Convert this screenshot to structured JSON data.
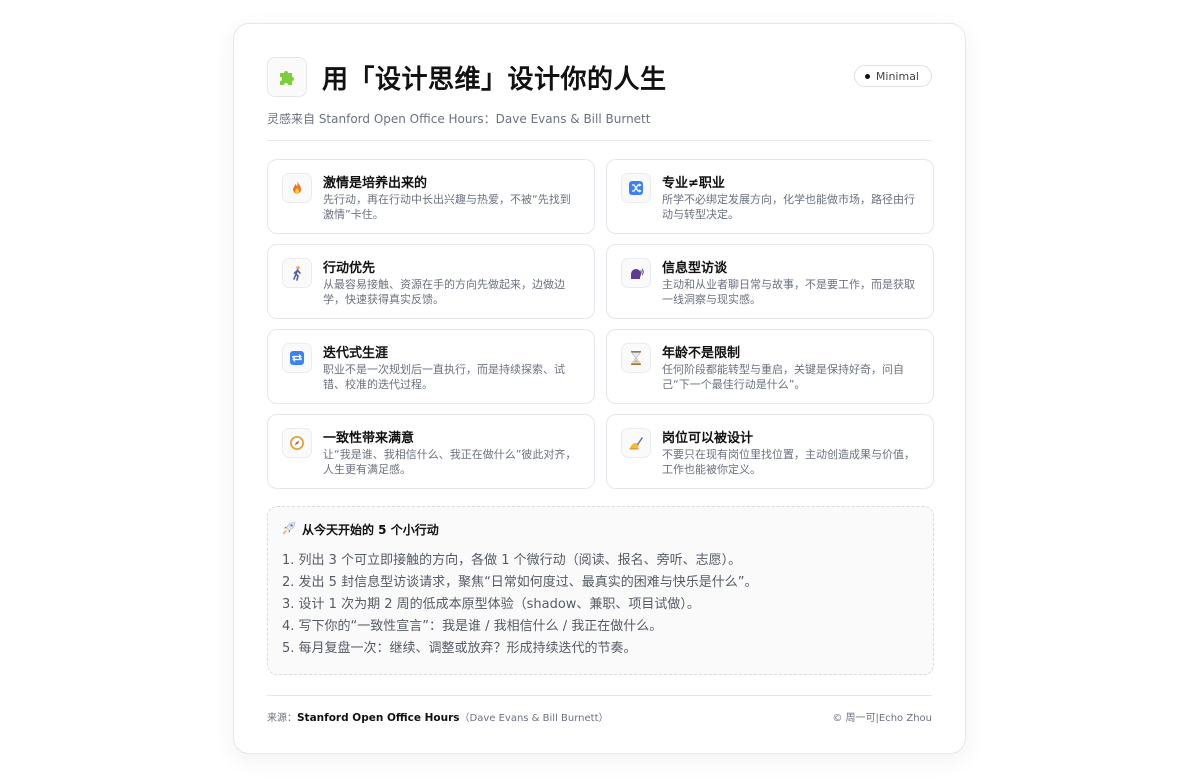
{
  "header": {
    "title": "用「设计思维」设计你的人生",
    "badge": "Minimal",
    "subtitle": "灵感来自 Stanford Open Office Hours：Dave Evans & Bill Burnett"
  },
  "principles": [
    {
      "icon": "fire-icon",
      "title": "激情是培养出来的",
      "desc": "先行动，再在行动中长出兴趣与热爱，不被“先找到激情”卡住。"
    },
    {
      "icon": "shuffle-icon",
      "title": "专业≠职业",
      "desc": "所学不必绑定发展方向，化学也能做市场，路径由行动与转型决定。"
    },
    {
      "icon": "walking-person-icon",
      "title": "行动优先",
      "desc": "从最容易接触、资源在手的方向先做起来，边做边学，快速获得真实反馈。"
    },
    {
      "icon": "speaking-head-icon",
      "title": "信息型访谈",
      "desc": "主动和从业者聊日常与故事，不是要工作，而是获取一线洞察与现实感。"
    },
    {
      "icon": "repeat-icon",
      "title": "迭代式生涯",
      "desc": "职业不是一次规划后一直执行，而是持续探索、试错、校准的迭代过程。"
    },
    {
      "icon": "hourglass-icon",
      "title": "年龄不是限制",
      "desc": "任何阶段都能转型与重启，关键是保持好奇，问自己“下一个最佳行动是什么”。"
    },
    {
      "icon": "compass-icon",
      "title": "一致性带来满意",
      "desc": "让“我是谁、我相信什么、我正在做什么”彼此对齐，人生更有满足感。"
    },
    {
      "icon": "writing-hand-icon",
      "title": "岗位可以被设计",
      "desc": "不要只在现有岗位里找位置，主动创造成果与价值，工作也能被你定义。"
    }
  ],
  "actions": {
    "heading": "从今天开始的 5 个小行动",
    "items": [
      "1. 列出 3 个可立即接触的方向，各做 1 个微行动（阅读、报名、旁听、志愿）。",
      "2. 发出 5 封信息型访谈请求，聚焦“日常如何度过、最真实的困难与快乐是什么”。",
      "3. 设计 1 次为期 2 周的低成本原型体验（shadow、兼职、项目试做）。",
      "4. 写下你的“一致性宣言”：我是谁 / 我相信什么 / 我正在做什么。",
      "5. 每月复盘一次：继续、调整或放弃？形成持续迭代的节奏。"
    ]
  },
  "footer": {
    "source_label": "来源：",
    "source_name": "Stanford Open Office Hours",
    "source_authors": "（Dave Evans & Bill Burnett）",
    "copyright": "© 周一可|Echo Zhou"
  }
}
